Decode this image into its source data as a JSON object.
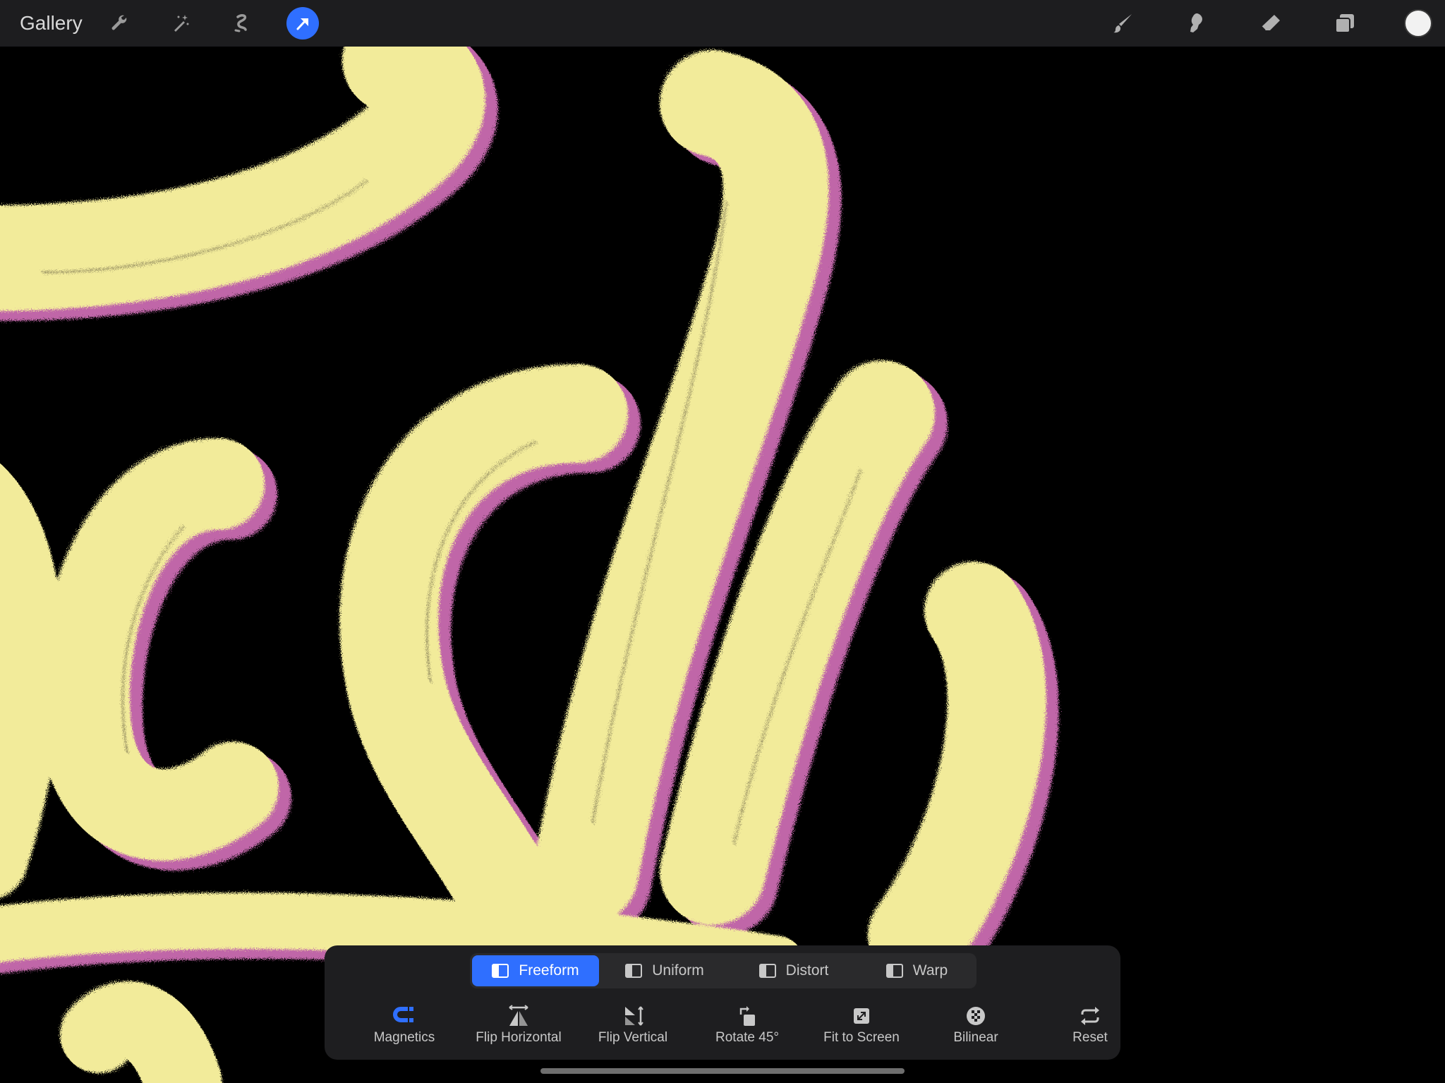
{
  "topbar": {
    "gallery_label": "Gallery",
    "left_tools": [
      {
        "name": "adjustments-wrench-icon",
        "active": false
      },
      {
        "name": "magic-wand-icon",
        "active": false
      },
      {
        "name": "selection-icon",
        "active": false
      },
      {
        "name": "transform-arrow-icon",
        "active": true
      }
    ],
    "right_tools": [
      {
        "name": "brush-icon"
      },
      {
        "name": "smudge-icon"
      },
      {
        "name": "eraser-icon"
      },
      {
        "name": "layers-icon"
      }
    ],
    "active_color": "#f2f2f2",
    "accent": "#2f6fff"
  },
  "canvas": {
    "stroke_fill": "#f2eb9a",
    "stroke_shadow": "#c066a8",
    "background": "#000000"
  },
  "transform_panel": {
    "modes": [
      {
        "label": "Freeform",
        "active": true
      },
      {
        "label": "Uniform",
        "active": false
      },
      {
        "label": "Distort",
        "active": false
      },
      {
        "label": "Warp",
        "active": false
      }
    ],
    "actions": [
      {
        "label": "Magnetics",
        "icon": "magnet-icon",
        "active": true
      },
      {
        "label": "Flip Horizontal",
        "icon": "flip-horizontal-icon",
        "active": false
      },
      {
        "label": "Flip Vertical",
        "icon": "flip-vertical-icon",
        "active": false
      },
      {
        "label": "Rotate 45°",
        "icon": "rotate-icon",
        "active": false
      },
      {
        "label": "Fit to Screen",
        "icon": "fit-screen-icon",
        "active": false
      },
      {
        "label": "Bilinear",
        "icon": "interpolation-icon",
        "active": false
      },
      {
        "label": "Reset",
        "icon": "reset-icon",
        "active": false
      }
    ]
  }
}
